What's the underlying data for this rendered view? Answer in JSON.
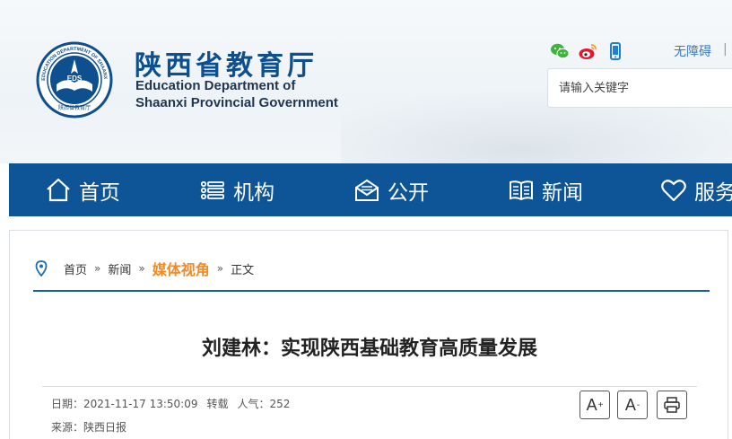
{
  "header": {
    "site_name_cn": "陕西省教育厅",
    "site_name_en_line1": "Education Department of",
    "site_name_en_line2": "Shaanxi Provincial Government",
    "seal_ring_text": "EDUCATION DEPARTMENT OF SHAANXI",
    "seal_center_text": "EDS",
    "seal_bottom_text": "陕西省教育厅",
    "social_icons": [
      "wechat-icon",
      "weibo-icon",
      "mobile-icon"
    ],
    "accessibility_link": "无障碍",
    "accessibility_sep": "|",
    "search_placeholder": "请输入关键字"
  },
  "nav": {
    "items": [
      {
        "label": "首页",
        "icon": "home-icon"
      },
      {
        "label": "机构",
        "icon": "list-icon"
      },
      {
        "label": "公开",
        "icon": "mail-icon"
      },
      {
        "label": "新闻",
        "icon": "book-icon"
      },
      {
        "label": "服务",
        "icon": "heart-icon"
      }
    ]
  },
  "breadcrumb": {
    "home": "首页",
    "news": "新闻",
    "category": "媒体视角",
    "current": "正文",
    "separator": "»"
  },
  "article": {
    "title": "刘建林：实现陕西基础教育高质量发展",
    "date_label": "日期：",
    "date_value": "2021-11-17 13:50:09",
    "repost": "转载",
    "views_label": "人气：",
    "views_value": "252",
    "source_label": "来源：",
    "source_value": "陕西日报"
  },
  "tools": {
    "font_larger": "A",
    "font_larger_mark": "+",
    "font_smaller": "A",
    "font_smaller_mark": "-"
  },
  "colors": {
    "nav_bg": "#0e5597",
    "brand_blue": "#0d4f8f",
    "category_orange": "#f08a24",
    "link_blue": "#3c7bbf"
  }
}
